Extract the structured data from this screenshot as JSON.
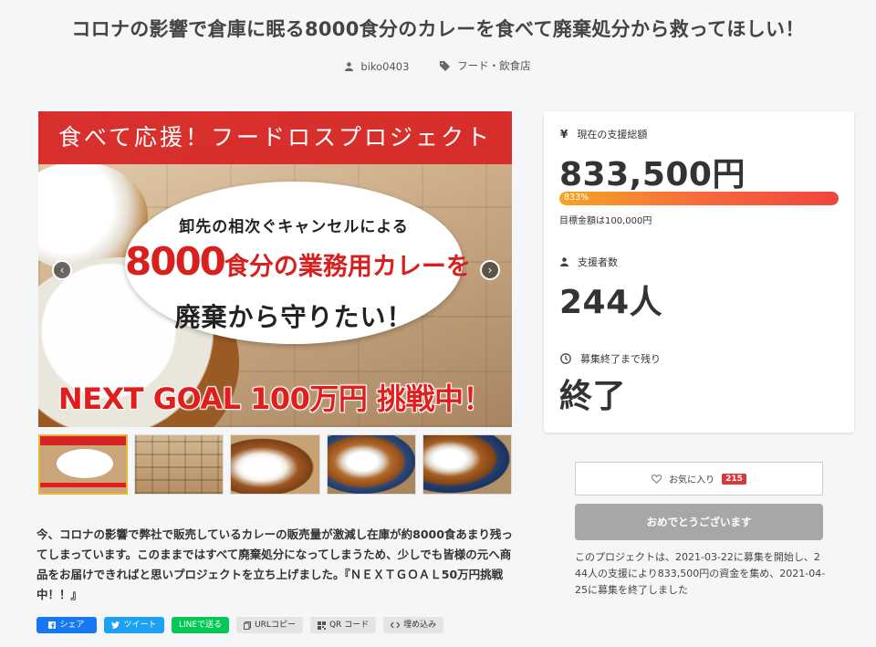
{
  "page": {
    "title": "コロナの影響で倉庫に眠る8000食分のカレーを食べて廃棄処分から救ってほしい！",
    "author": "biko0403",
    "category": "フード・飲食店"
  },
  "hero": {
    "banner": "食べて応援！フードロスプロジェクト",
    "line1": "卸先の相次ぐキャンセルによる",
    "line2_big": "8000",
    "line2_rest": "食分の業務用カレーを",
    "line3": "廃棄から守りたい！",
    "next_goal": "NEXT GOAL 100万円 挑戦中！",
    "prev_glyph": "‹",
    "next_glyph": "›"
  },
  "stats": {
    "total_label": "現在の支援総額",
    "total_value": "833,500円",
    "progress_label": "833%",
    "progress_percent": 833,
    "goal_text": "目標金額は100,000円",
    "backers_label": "支援者数",
    "backers_value": "244人",
    "remaining_label": "募集終了まで残り",
    "remaining_value": "終了",
    "yen_glyph": "¥"
  },
  "actions": {
    "favorite_label": "お気に入り",
    "favorite_count": "215",
    "congrats_label": "おめでとうございます",
    "summary": "このプロジェクトは、2021-03-22に募集を開始し、244人の支援により833,500円の資金を集め、2021-04-25に募集を終了しました"
  },
  "description": "今、コロナの影響で弊社で販売しているカレーの販売量が激減し在庫が約8000食あまり残ってしまっています。このままではすべて廃棄処分になってしまうため、少しでも皆様の元へ商品をお届けできればと思いプロジェクトを立ち上げました。『ＮＥＸＴＧＯＡＬ50万円挑戦中！！』",
  "share": {
    "facebook": "シェア",
    "twitter": "ツイート",
    "line": "LINEで送る",
    "url": "URLコピー",
    "qr": "QR コード",
    "embed": "埋め込み"
  },
  "colors": {
    "brand_red": "#d62323",
    "progress_start": "#f5a623",
    "progress_end": "#f0453d",
    "congrats_gray": "#a7a7a7"
  }
}
